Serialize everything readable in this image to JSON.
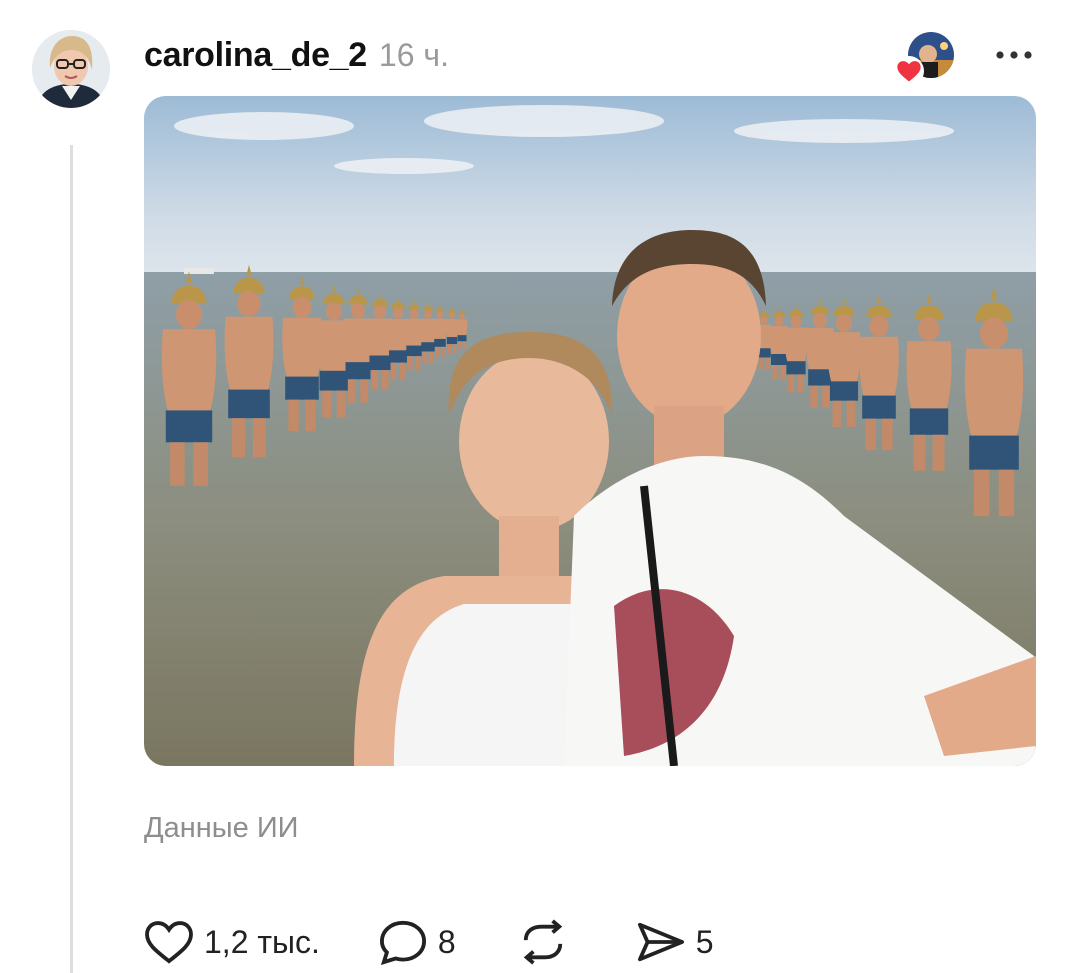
{
  "post": {
    "username": "carolina_de_2",
    "time": "16 ч.",
    "ai_label": "Данные ИИ"
  },
  "actions": {
    "likes": "1,2 тыс.",
    "comments": "8",
    "shares": "5"
  },
  "icons": {
    "like": "heart-icon",
    "comment": "comment-bubble-icon",
    "repost": "repost-icon",
    "share": "send-icon",
    "more": "more-dots-icon"
  },
  "colors": {
    "heart_badge": "#ef3340",
    "secondary_text": "#9a9a9a",
    "thread_line": "#dedede"
  }
}
